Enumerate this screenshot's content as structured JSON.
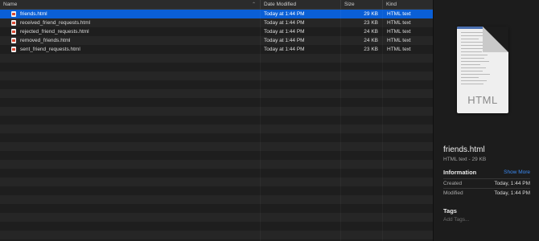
{
  "columns": {
    "name": "Name",
    "date_modified": "Date Modified",
    "size": "Size",
    "kind": "Kind"
  },
  "files": [
    {
      "name": "friends.html",
      "date": "Today at 1:44 PM",
      "size": "29 KB",
      "kind": "HTML text",
      "selected": true
    },
    {
      "name": "received_friend_requests.html",
      "date": "Today at 1:44 PM",
      "size": "23 KB",
      "kind": "HTML text",
      "selected": false
    },
    {
      "name": "rejected_friend_requests.html",
      "date": "Today at 1:44 PM",
      "size": "24 KB",
      "kind": "HTML text",
      "selected": false
    },
    {
      "name": "removed_friends.html",
      "date": "Today at 1:44 PM",
      "size": "24 KB",
      "kind": "HTML text",
      "selected": false
    },
    {
      "name": "sent_friend_requests.html",
      "date": "Today at 1:44 PM",
      "size": "23 KB",
      "kind": "HTML text",
      "selected": false
    }
  ],
  "preview": {
    "thumbnail_label": "HTML",
    "file_name": "friends.html",
    "subtitle": "HTML text - 29 KB",
    "information_title": "Information",
    "show_more": "Show More",
    "created_label": "Created",
    "created_value": "Today, 1:44 PM",
    "modified_label": "Modified",
    "modified_value": "Today, 1:44 PM",
    "tags_title": "Tags",
    "add_tags": "Add Tags..."
  },
  "colors": {
    "selection": "#0a5fd6",
    "link": "#3b8bf5",
    "file_icon_accent": "#d9462f"
  },
  "icons": {
    "file": "html-file-icon",
    "sort": "chevron-up-icon"
  }
}
